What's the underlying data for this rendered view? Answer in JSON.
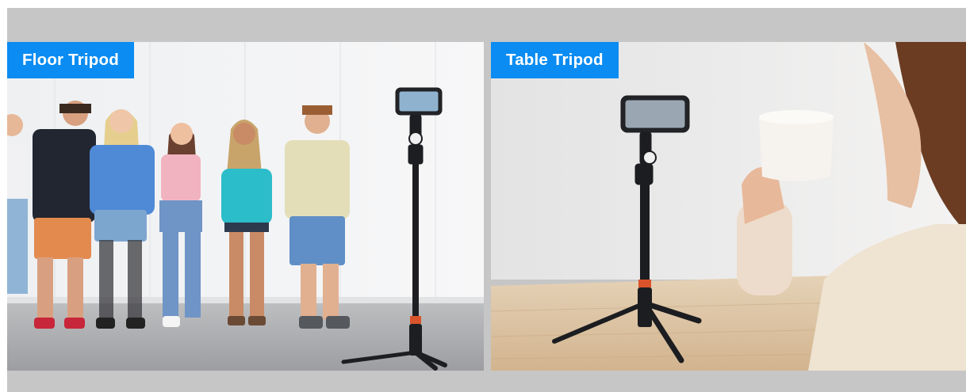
{
  "panels": [
    {
      "label": "Floor Tripod"
    },
    {
      "label": "Table Tripod"
    }
  ],
  "colors": {
    "accent": "#0a8cf2",
    "frame": "#c6c6c6"
  }
}
